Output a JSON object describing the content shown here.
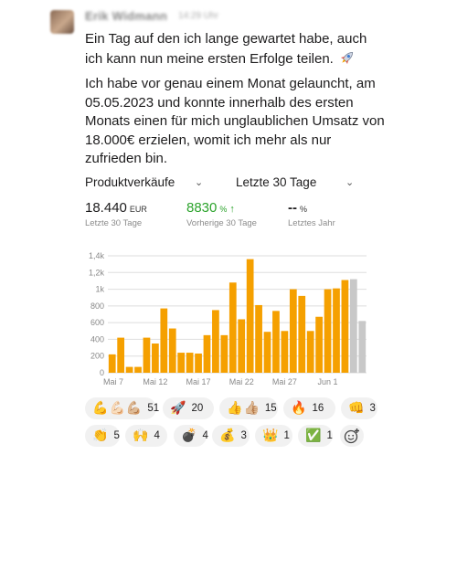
{
  "message": {
    "author": "Erik Widmann",
    "timestamp": "14:29 Uhr",
    "paragraph1": "Ein Tag auf den ich lange gewartet habe, auch ich kann nun meine ersten Erfolge teilen.",
    "paragraph2": "Ich habe vor genau einem Monat gelauncht, am 05.05.2023 und konnte innerhalb des ersten Monats einen für mich unglaublichen Umsatz von 18.000€ erzielen, womit ich mehr als nur zufrieden bin."
  },
  "selectors": {
    "metric": "Produktverkäufe",
    "range": "Letzte 30 Tage"
  },
  "stats": [
    {
      "value": "18.440",
      "unit": "EUR",
      "label": "Letzte 30 Tage"
    },
    {
      "value": "8830",
      "unit": "%",
      "label": "Vorherige 30 Tage"
    },
    {
      "value": "--",
      "unit": "%",
      "label": "Letztes Jahr"
    }
  ],
  "chart_data": {
    "type": "bar",
    "x_tick_labels": [
      "Mai 7",
      "Mai 12",
      "Mai 17",
      "Mai 22",
      "Mai 27",
      "Jun 1"
    ],
    "y_tick_labels": [
      "0",
      "200",
      "400",
      "600",
      "800",
      "1k",
      "1,2k",
      "1,4k"
    ],
    "ylim": [
      0,
      1400
    ],
    "grid": true,
    "colors": {
      "bar": "#f5a000",
      "comparison": "#c8c8c8"
    },
    "values": [
      220,
      420,
      70,
      70,
      420,
      350,
      770,
      530,
      240,
      240,
      230,
      450,
      750,
      450,
      1080,
      640,
      1360,
      810,
      490,
      740,
      500,
      1000,
      920,
      500,
      670,
      1000,
      1010,
      1110
    ],
    "comparison_values": [
      1120,
      620
    ]
  },
  "reactions": [
    {
      "emoji": [
        "💪",
        "💪🏻",
        "💪🏼"
      ],
      "count": "51"
    },
    {
      "emoji": [
        "🚀"
      ],
      "count": "20"
    },
    {
      "emoji": [
        "👍",
        "👍🏼"
      ],
      "count": "15"
    },
    {
      "emoji": [
        "🔥"
      ],
      "count": "16"
    },
    {
      "emoji": [
        "👊"
      ],
      "count": "3"
    },
    {
      "emoji": [
        "👏"
      ],
      "count": "5"
    },
    {
      "emoji": [
        "🙌"
      ],
      "count": "4"
    },
    {
      "emoji": [
        "💣"
      ],
      "count": "4"
    },
    {
      "emoji": [
        "💰"
      ],
      "count": "3"
    },
    {
      "emoji": [
        "👑"
      ],
      "count": "1"
    },
    {
      "emoji": [
        "✅"
      ],
      "count": "1"
    }
  ],
  "icons": {
    "add_reaction": "add-reaction-icon",
    "rocket": "rocket-icon"
  }
}
